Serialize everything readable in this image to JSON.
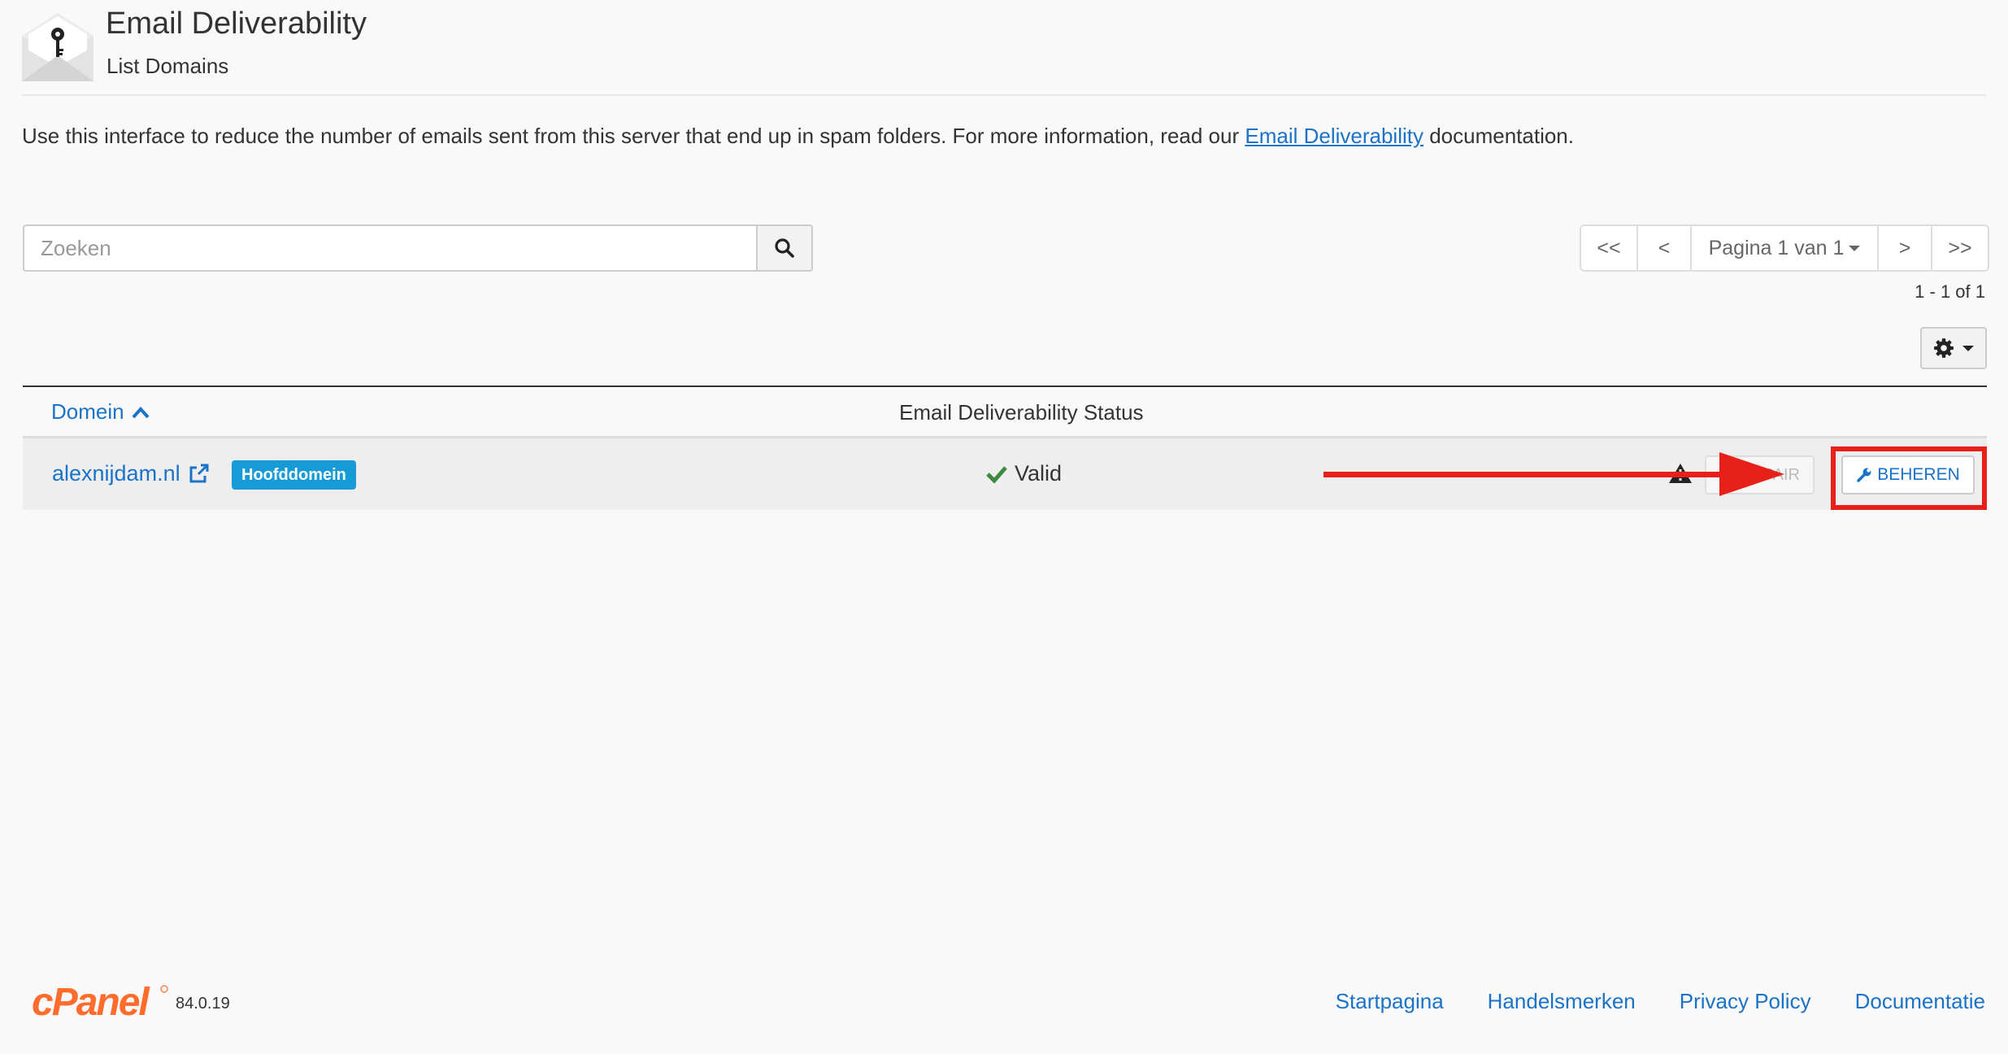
{
  "header": {
    "title": "Email Deliverability",
    "subtitle": "List Domains"
  },
  "intro": {
    "text_before": "Use this interface to reduce the number of emails sent from this server that end up in spam folders. For more information, read our ",
    "link_text": "Email Deliverability",
    "text_after": " documentation."
  },
  "search": {
    "placeholder": "Zoeken",
    "value": ""
  },
  "pager": {
    "first": "<<",
    "prev": "<",
    "page_label": "Pagina 1 van 1",
    "next": ">",
    "last": ">>",
    "range": "1 - 1 of 1"
  },
  "table": {
    "columns": {
      "domain": "Domein",
      "status": "Email Deliverability Status"
    },
    "rows": [
      {
        "domain": "alexnijdam.nl",
        "badge": "Hoofddomein",
        "status": "Valid",
        "repair_label": "REPAIR",
        "manage_label": "BEHEREN"
      }
    ]
  },
  "footer": {
    "version": "84.0.19",
    "links": [
      "Startpagina",
      "Handelsmerken",
      "Privacy Policy",
      "Documentatie"
    ]
  },
  "colors": {
    "link": "#1a73c8",
    "badge": "#179bd7",
    "valid": "#3c8a3e",
    "annotation": "#e8201a",
    "cpanel": "#ff6c2c"
  },
  "icons": {
    "app": "email-key-icon",
    "search": "search-icon",
    "settings": "gear-icon",
    "sort": "chevron-up-icon",
    "external": "external-link-icon",
    "valid": "checkmark-icon",
    "warning": "warning-icon",
    "repair": "refresh-icon",
    "manage": "wrench-icon"
  }
}
